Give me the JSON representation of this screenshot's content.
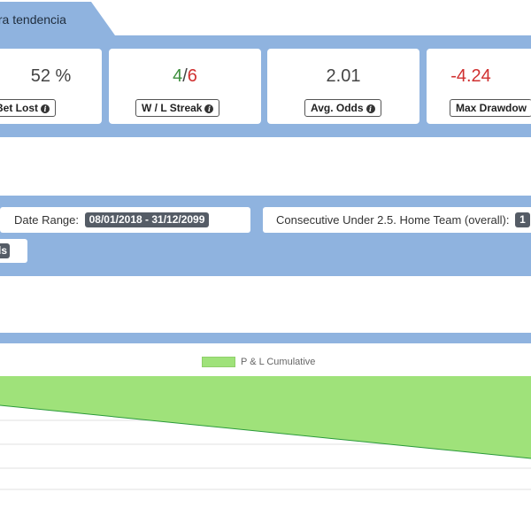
{
  "tab": {
    "label": "tra tendencia"
  },
  "stats": [
    {
      "value": "52 %",
      "label": "Bet Lost"
    },
    {
      "value_win": "4",
      "value_sep": "/",
      "value_loss": "6",
      "label": "W / L Streak"
    },
    {
      "value": "2.01",
      "label": "Avg. Odds"
    },
    {
      "value": "-4.24",
      "label": "Max Drawdow"
    }
  ],
  "filters": {
    "date_range_label": "Date Range:",
    "date_range_value": "08/01/2018 - 31/12/2099",
    "consecutive_label": "Consecutive Under 2.5. Home Team (overall):",
    "consecutive_value": "1",
    "row2_partial": "ls"
  },
  "colors": {
    "band": "#8fb3df",
    "area_fill": "#9fe27a",
    "area_line": "#2a9a3a",
    "positive": "#3d8f3d",
    "negative": "#d03030"
  },
  "chart_data": {
    "type": "area",
    "series": [
      {
        "name": "P & L Cumulative",
        "values": [
          0,
          -1.5
        ]
      }
    ],
    "grid": true,
    "legend": "top-center"
  }
}
